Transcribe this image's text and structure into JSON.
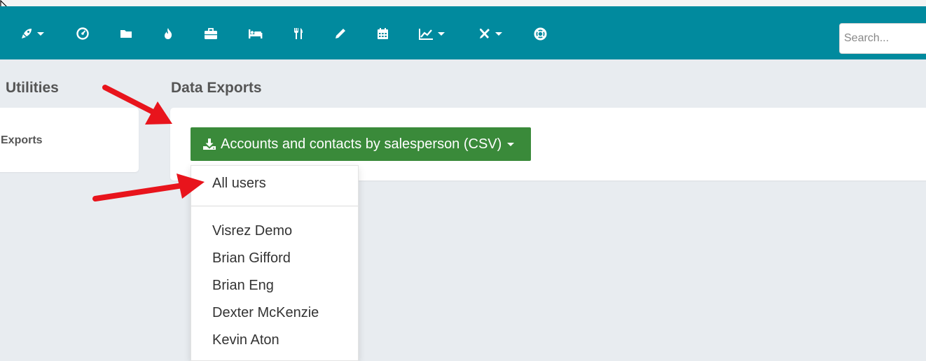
{
  "header": {
    "search_placeholder": "Search...",
    "nav_icons": [
      "rocket-icon",
      "tachometer-icon",
      "folder-icon",
      "fire-icon",
      "briefcase-icon",
      "bed-icon",
      "utensils-icon",
      "pencil-icon",
      "calendar-icon",
      "chart-line-icon",
      "tools-icon",
      "life-ring-icon"
    ]
  },
  "sidebar": {
    "title": "Utilities",
    "items": [
      {
        "label": "Exports"
      }
    ]
  },
  "main": {
    "title": "Data Exports",
    "export_button": {
      "label": "Accounts and contacts by salesperson (CSV)"
    },
    "dropdown": {
      "all_label": "All users",
      "users": [
        "Visrez Demo",
        "Brian Gifford",
        "Brian Eng",
        "Dexter McKenzie",
        "Kevin Aton"
      ]
    }
  },
  "colors": {
    "navbar": "#018a9e",
    "button": "#3a8a3a",
    "annotation": "#e8141c",
    "background": "#e8ecf0"
  }
}
